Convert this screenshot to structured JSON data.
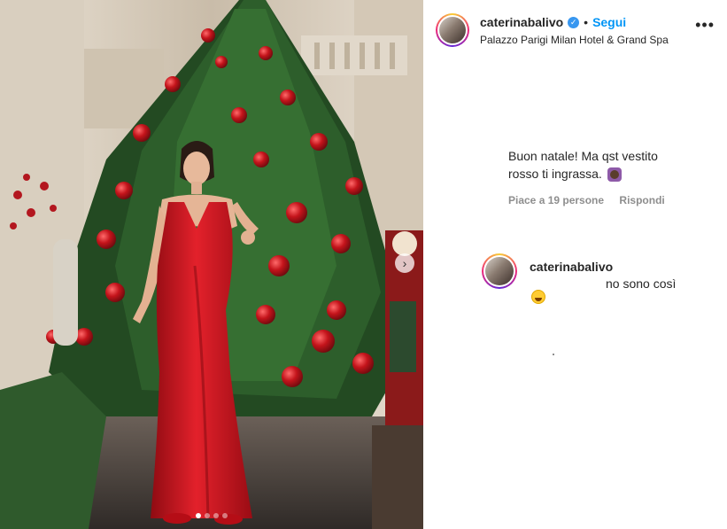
{
  "post": {
    "username": "caterinabalivo",
    "separator": "•",
    "follow_label": "Segui",
    "location": "Palazzo Parigi Milan Hotel & Grand Spa",
    "more_icon": "more-options-icon",
    "carousel": {
      "dots": 4,
      "active_index": 0
    }
  },
  "comment": {
    "text": "Buon natale! Ma qst vestito rosso ti ingrassa.",
    "likes_label": "Piace a 19 persone",
    "reply_label": "Rispondi"
  },
  "reply": {
    "username": "caterinabalivo",
    "text": "no sono così"
  },
  "colors": {
    "accent": "#0095f6",
    "verified": "#3897f0",
    "dress": "#c8101a",
    "muted": "#8e8e8e"
  }
}
